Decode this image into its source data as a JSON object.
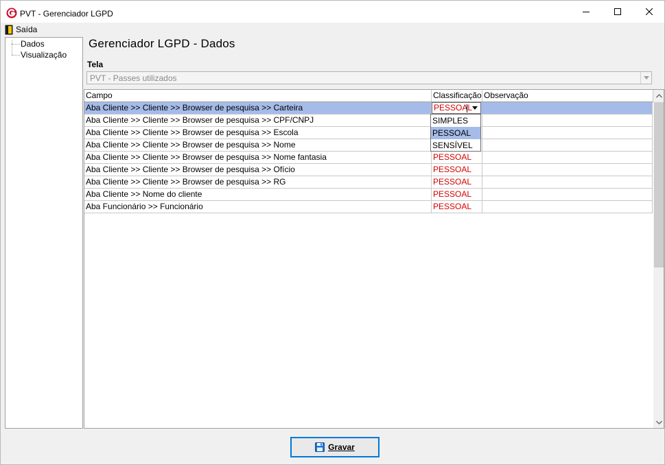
{
  "window": {
    "title": "PVT - Gerenciador LGPD",
    "controls": {
      "minimize": "minimize-icon",
      "maximize": "maximize-icon",
      "close": "close-icon"
    }
  },
  "menu": {
    "exit_label": "Saída"
  },
  "sidebar": {
    "items": [
      {
        "label": "Dados"
      },
      {
        "label": "Visualização"
      }
    ]
  },
  "main": {
    "title": "Gerenciador LGPD - Dados",
    "screen_label": "Tela",
    "screen_value": "PVT - Passes utilizados"
  },
  "grid": {
    "columns": [
      "Campo",
      "Classificação",
      "Observação"
    ],
    "rows": [
      {
        "campo": "Aba Cliente >> Cliente >> Browser de pesquisa >> Carteira",
        "classificacao": "PESSOAL",
        "observacao": ""
      },
      {
        "campo": "Aba Cliente >> Cliente >> Browser de pesquisa >> CPF/CNPJ",
        "classificacao": "",
        "observacao": ""
      },
      {
        "campo": "Aba Cliente >> Cliente >> Browser de pesquisa >> Escola",
        "classificacao": "",
        "observacao": ""
      },
      {
        "campo": "Aba Cliente >> Cliente >> Browser de pesquisa >> Nome",
        "classificacao": "",
        "observacao": ""
      },
      {
        "campo": "Aba Cliente >> Cliente >> Browser de pesquisa >> Nome fantasia",
        "classificacao": "PESSOAL",
        "observacao": ""
      },
      {
        "campo": "Aba Cliente >> Cliente >> Browser de pesquisa >> Ofício",
        "classificacao": "PESSOAL",
        "observacao": ""
      },
      {
        "campo": "Aba Cliente >> Cliente >> Browser de pesquisa >> RG",
        "classificacao": "PESSOAL",
        "observacao": ""
      },
      {
        "campo": "Aba Cliente >> Nome do cliente",
        "classificacao": "PESSOAL",
        "observacao": ""
      },
      {
        "campo": "Aba Funcionário >> Funcionário",
        "classificacao": "PESSOAL",
        "observacao": ""
      }
    ],
    "dropdown_options": [
      "SIMPLES",
      "PESSOAL",
      "SENSÍVEL"
    ],
    "highlighted_option": "PESSOAL"
  },
  "actions": {
    "save_label": "Gravar"
  },
  "colors": {
    "selection": "#a5bce9",
    "classification_text": "#d40000",
    "button_focus": "#0078d7"
  }
}
